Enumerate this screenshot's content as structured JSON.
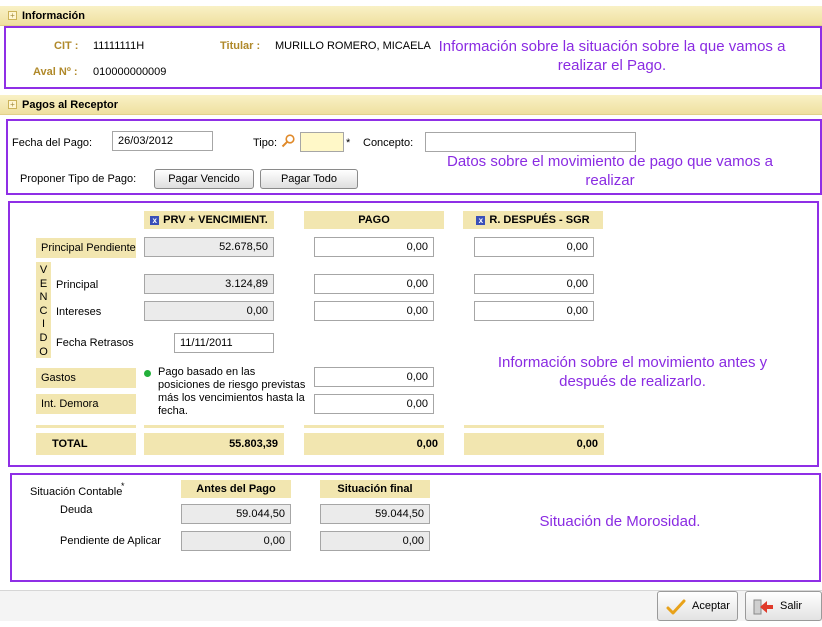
{
  "info": {
    "header": "Información",
    "cit_label": "CIT :",
    "cit_value": "11111111H",
    "titular_label": "Titular :",
    "titular_value": "MURILLO ROMERO, MICAELA",
    "aval_label": "Aval Nº :",
    "aval_value": "010000000009",
    "note": "Información sobre la situación sobre la que vamos a realizar el Pago."
  },
  "pagos": {
    "header": "Pagos al Receptor",
    "fecha_label": "Fecha del Pago:",
    "fecha_value": "26/03/2012",
    "tipo_label": "Tipo:",
    "tipo_value": "",
    "required_mark": "*",
    "concepto_label": "Concepto:",
    "concepto_value": "",
    "proponer_label": "Proponer Tipo de Pago:",
    "btn_vencido": "Pagar Vencido",
    "btn_todo": "Pagar Todo",
    "note": "Datos sobre el movimiento de pago que vamos a realizar"
  },
  "movimiento": {
    "col_prv": "PRV + VENCIMIENT.",
    "col_pago": "PAGO",
    "col_despues": "R. DESPUÉS - SGR",
    "row_principal_pendiente": "Principal Pendiente",
    "vencido_letters": [
      "V",
      "E",
      "N",
      "C",
      "I",
      "D",
      "O"
    ],
    "row_principal": "Principal",
    "row_intereses": "Intereses",
    "row_fecha_retrasos": "Fecha Retrasos",
    "row_gastos": "Gastos",
    "row_int_demora": "Int. Demora",
    "row_total": "TOTAL",
    "prv": {
      "principal_pendiente": "52.678,50",
      "principal": "3.124,89",
      "intereses": "0,00",
      "fecha_retrasos": "11/11/2011",
      "total": "55.803,39"
    },
    "pago": {
      "principal_pendiente": "0,00",
      "principal": "0,00",
      "intereses": "0,00",
      "gastos": "0,00",
      "int_demora": "0,00",
      "total": "0,00"
    },
    "despues": {
      "principal_pendiente": "0,00",
      "principal": "0,00",
      "intereses": "0,00",
      "total": "0,00"
    },
    "info_text": "Pago basado en las posiciones de riesgo previstas más los vencimientos hasta la fecha.",
    "note": "Información sobre el movimiento antes y después de realizarlo."
  },
  "situacion": {
    "label": "Situación Contable",
    "asterisk": "*",
    "col_antes": "Antes del Pago",
    "col_final": "Situación final",
    "row_deuda": "Deuda",
    "row_pendiente": "Pendiente de Aplicar",
    "antes": {
      "deuda": "59.044,50",
      "pendiente": "0,00"
    },
    "final": {
      "deuda": "59.044,50",
      "pendiente": "0,00"
    },
    "note": "Situación de Morosidad."
  },
  "footer": {
    "aceptar": "Aceptar",
    "salir": "Salir"
  },
  "colors": {
    "accent_frame": "#8f2fe6",
    "note_text": "#8a2be2",
    "header_band": "#efe0a0",
    "gold_label": "#b0892a"
  }
}
